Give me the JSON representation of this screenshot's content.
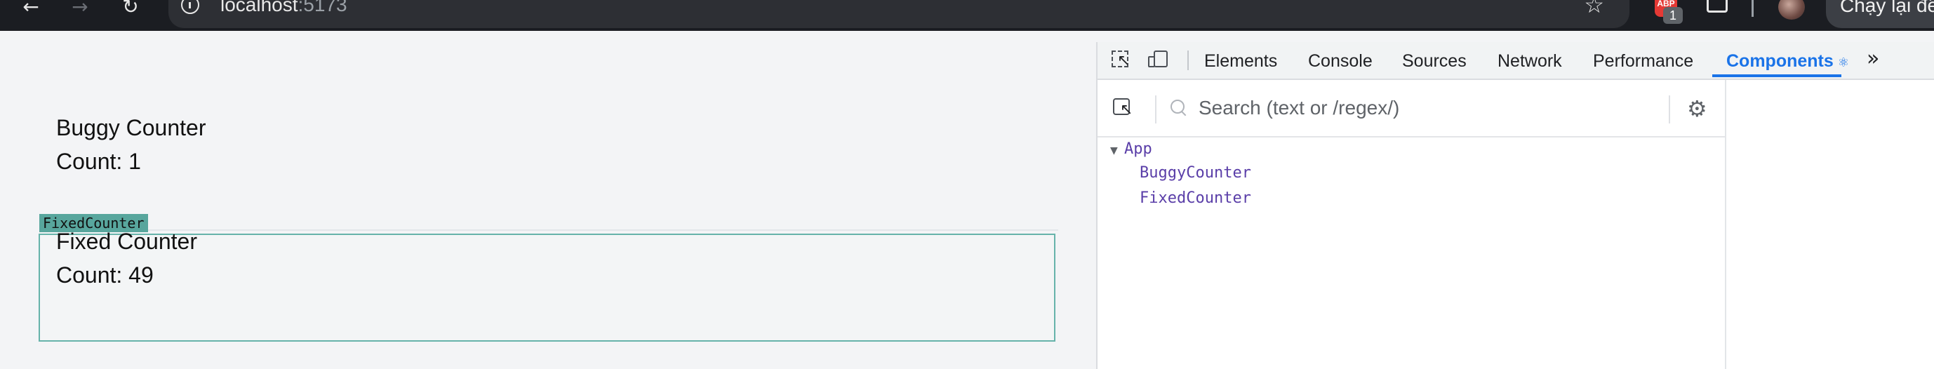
{
  "browser": {
    "url_host": "localhost",
    "url_port": ":5173",
    "ext_badge_count": "1",
    "ext_label": "ABP",
    "relaunch_label": "Chạy lại để"
  },
  "app": {
    "buggy": {
      "title": "Buggy Counter",
      "count": "Count: 1"
    },
    "highlight_label": "FixedCounter",
    "fixed": {
      "title": "Fixed Counter",
      "count": "Count: 49"
    }
  },
  "devtools": {
    "tabs": [
      "Elements",
      "Console",
      "Sources",
      "Network",
      "Performance"
    ],
    "active_tab": "Components",
    "active_tab_icon": "⚛",
    "more_tabs": "»",
    "search_placeholder": "Search (text or /regex/)",
    "tree": {
      "root": "App",
      "children": [
        "BuggyCounter",
        "FixedCounter"
      ]
    }
  },
  "colors": {
    "highlight_fill": "#58a69d",
    "highlight_border": "#66b3aa",
    "active_tab": "#1a73e8",
    "component_name": "#5a3ea8"
  }
}
